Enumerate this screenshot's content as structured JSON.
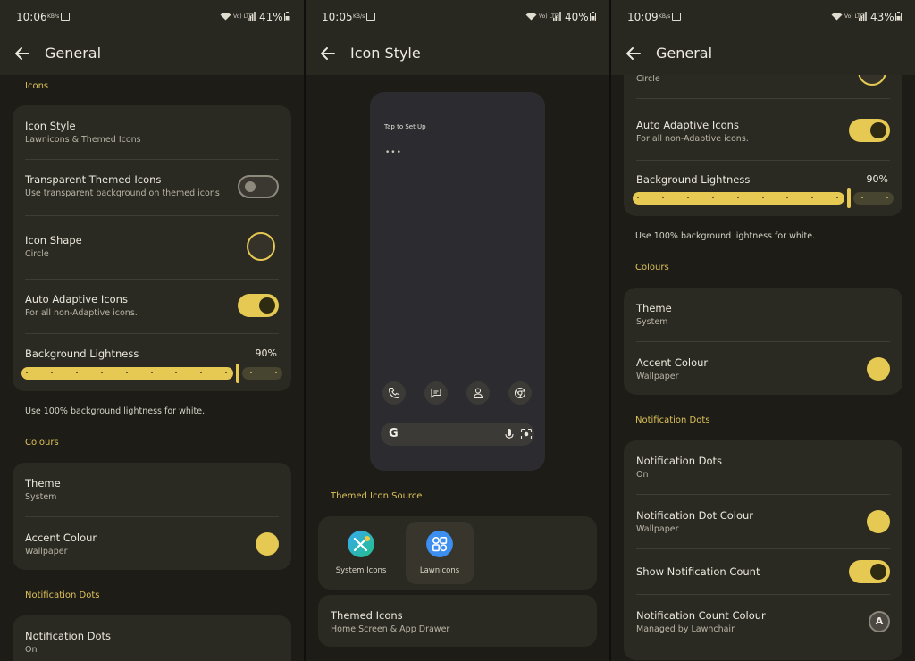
{
  "panels": [
    {
      "status": {
        "time": "10:06",
        "speed": "KB/s",
        "net": "Vo) LTE",
        "battery": "41%"
      },
      "title": "General",
      "sections": {
        "icons": "Icons",
        "colours": "Colours",
        "notification_dots": "Notification Dots"
      },
      "icon_style": {
        "title": "Icon Style",
        "subtitle": "Lawnicons & Themed Icons"
      },
      "transparent_themed": {
        "title": "Transparent Themed Icons",
        "subtitle": "Use transparent background on themed icons",
        "enabled": false
      },
      "icon_shape": {
        "title": "Icon Shape",
        "subtitle": "Circle"
      },
      "auto_adaptive": {
        "title": "Auto Adaptive Icons",
        "subtitle": "For all non-Adaptive icons.",
        "enabled": true
      },
      "bg_lightness": {
        "title": "Background Lightness",
        "value": "90%",
        "level": 0.9
      },
      "helper": "Use 100% background lightness for white.",
      "theme": {
        "title": "Theme",
        "subtitle": "System"
      },
      "accent": {
        "title": "Accent Colour",
        "subtitle": "Wallpaper"
      },
      "notif_dots": {
        "title": "Notification Dots",
        "subtitle": "On"
      }
    },
    {
      "status": {
        "time": "10:05",
        "speed": "KB/s",
        "net": "Vo) LTE",
        "battery": "40%"
      },
      "title": "Icon Style",
      "preview_text": "Tap to Set Up",
      "preview_dots": "•••",
      "google_glyph": "G",
      "section_source": "Themed Icon Source",
      "sources": [
        {
          "label": "System Icons",
          "selected": false
        },
        {
          "label": "Lawnicons",
          "selected": true
        }
      ],
      "themed_icons": {
        "title": "Themed Icons",
        "subtitle": "Home Screen & App Drawer"
      }
    },
    {
      "status": {
        "time": "10:09",
        "speed": "KB/s",
        "net": "Vo) LTE",
        "battery": "43%"
      },
      "title": "General",
      "partial_shape_subtitle": "Circle",
      "auto_adaptive": {
        "title": "Auto Adaptive Icons",
        "subtitle": "For all non-Adaptive icons.",
        "enabled": true
      },
      "bg_lightness": {
        "title": "Background Lightness",
        "value": "90%",
        "level": 0.9
      },
      "helper": "Use 100% background lightness for white.",
      "sections": {
        "colours": "Colours",
        "notification_dots": "Notification Dots"
      },
      "theme": {
        "title": "Theme",
        "subtitle": "System"
      },
      "accent": {
        "title": "Accent Colour",
        "subtitle": "Wallpaper"
      },
      "notif_dots": {
        "title": "Notification Dots",
        "subtitle": "On"
      },
      "notif_dot_colour": {
        "title": "Notification Dot Colour",
        "subtitle": "Wallpaper"
      },
      "show_count": {
        "title": "Show Notification Count",
        "enabled": true
      },
      "count_colour": {
        "title": "Notification Count Colour",
        "subtitle": "Managed by Lawnchair",
        "icon_letter": "A"
      }
    }
  ],
  "colors": {
    "accent": "#e6c952",
    "surface": "#2b2a22",
    "background": "#1d1c17"
  }
}
